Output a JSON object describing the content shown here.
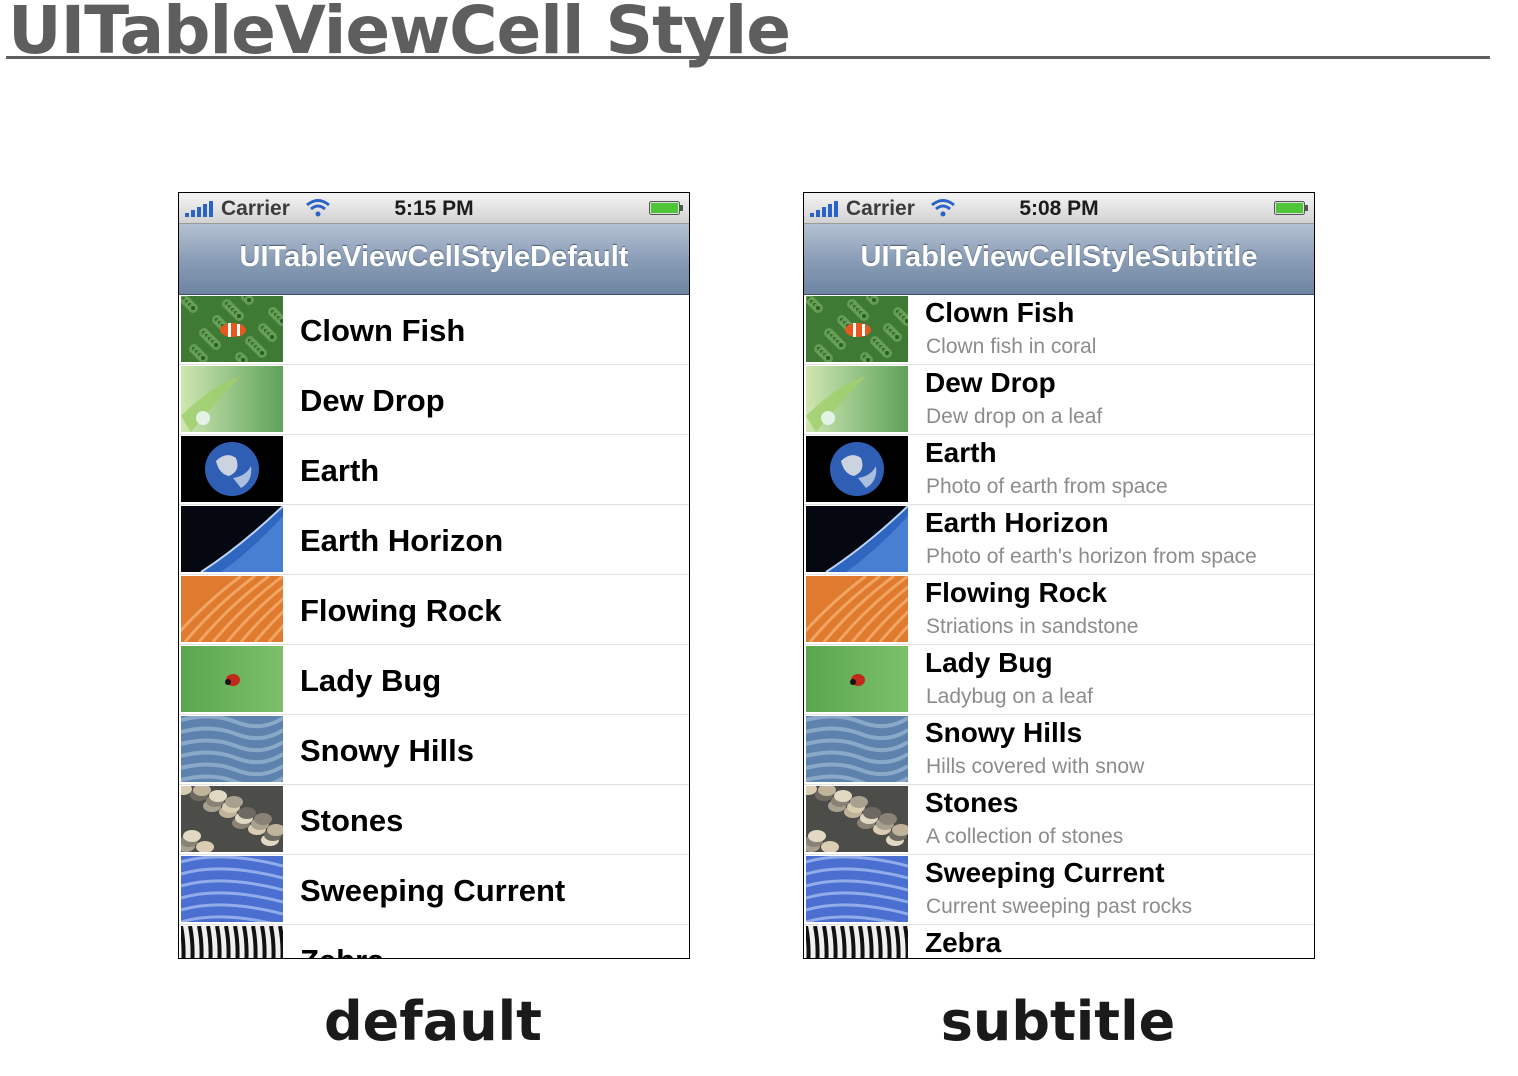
{
  "slide": {
    "title": "UITableViewCell Style"
  },
  "phones": [
    {
      "style": "default",
      "caption": "default",
      "status": {
        "carrier": "Carrier",
        "time": "5:15 PM"
      },
      "nav_title": "UITableViewCellStyleDefault",
      "rows": [
        {
          "title": "Clown Fish",
          "thumb": "clownfish"
        },
        {
          "title": "Dew Drop",
          "thumb": "dewdrop"
        },
        {
          "title": "Earth",
          "thumb": "earth"
        },
        {
          "title": "Earth Horizon",
          "thumb": "horizon"
        },
        {
          "title": "Flowing Rock",
          "thumb": "rock"
        },
        {
          "title": "Lady Bug",
          "thumb": "ladybug"
        },
        {
          "title": "Snowy Hills",
          "thumb": "hills"
        },
        {
          "title": "Stones",
          "thumb": "stones"
        },
        {
          "title": "Sweeping Current",
          "thumb": "current"
        },
        {
          "title": "Zebra",
          "thumb": "zebra"
        }
      ]
    },
    {
      "style": "subtitle",
      "caption": "subtitle",
      "status": {
        "carrier": "Carrier",
        "time": "5:08 PM"
      },
      "nav_title": "UITableViewCellStyleSubtitle",
      "rows": [
        {
          "title": "Clown Fish",
          "subtitle": "Clown fish in coral",
          "thumb": "clownfish"
        },
        {
          "title": "Dew Drop",
          "subtitle": "Dew drop on a leaf",
          "thumb": "dewdrop"
        },
        {
          "title": "Earth",
          "subtitle": "Photo of earth from space",
          "thumb": "earth"
        },
        {
          "title": "Earth Horizon",
          "subtitle": "Photo of earth's horizon from space",
          "thumb": "horizon"
        },
        {
          "title": "Flowing Rock",
          "subtitle": "Striations in sandstone",
          "thumb": "rock"
        },
        {
          "title": "Lady Bug",
          "subtitle": "Ladybug on a leaf",
          "thumb": "ladybug"
        },
        {
          "title": "Snowy Hills",
          "subtitle": "Hills covered with snow",
          "thumb": "hills"
        },
        {
          "title": "Stones",
          "subtitle": "A collection of stones",
          "thumb": "stones"
        },
        {
          "title": "Sweeping Current",
          "subtitle": "Current sweeping past rocks",
          "thumb": "current"
        },
        {
          "title": "Zebra",
          "subtitle": "",
          "thumb": "zebra"
        }
      ]
    }
  ]
}
